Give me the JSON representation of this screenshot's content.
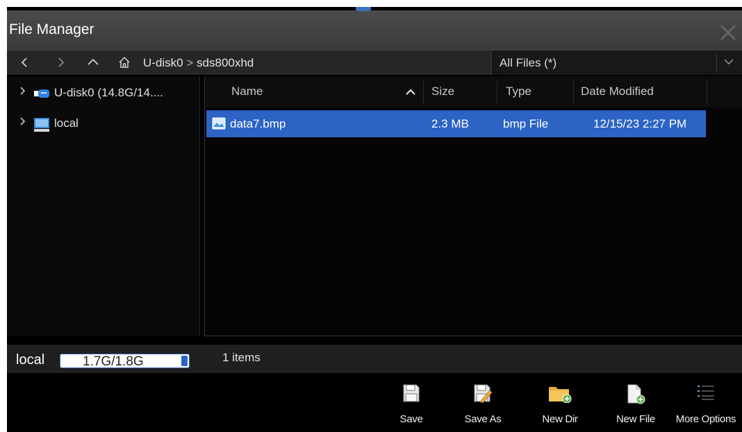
{
  "window": {
    "title": "File Manager",
    "close_icon": "close-icon"
  },
  "nav": {
    "back_icon": "chevron-left-icon",
    "forward_icon": "chevron-right-icon",
    "up_icon": "chevron-up-icon",
    "home_icon": "home-icon",
    "path_root": "U-disk0",
    "path_separator": ">",
    "path_folder": "sds800xhd",
    "filter": {
      "value": "All Files (*)",
      "icon": "chevron-down-icon"
    }
  },
  "sidebar": {
    "items": [
      {
        "label": "U-disk0  (14.8G/14....",
        "icon": "usb-drive-icon",
        "expand_icon": "chevron-right-icon"
      },
      {
        "label": "local",
        "icon": "monitor-drive-icon",
        "expand_icon": "chevron-right-icon"
      }
    ]
  },
  "file_list": {
    "columns": [
      "Name",
      "Size",
      "Type",
      "Date Modified"
    ],
    "sort_icon": "sort-ascending-icon",
    "rows": [
      {
        "name": "data7.bmp",
        "size": "2.3 MB",
        "type": "bmp File",
        "date": "12/15/23 2:27 PM",
        "icon": "image-file-icon"
      }
    ]
  },
  "status": {
    "storage_name": "local",
    "storage_usage": "1.7G/1.8G",
    "storage_fraction": 0.94,
    "item_count": "1 items"
  },
  "toolbar": {
    "buttons": [
      {
        "label": "Save",
        "icon": "floppy-disk-icon"
      },
      {
        "label": "Save As",
        "icon": "floppy-pencil-icon"
      },
      {
        "label": "New Dir",
        "icon": "new-folder-icon"
      },
      {
        "label": "New File",
        "icon": "new-file-icon"
      },
      {
        "label": "More Options",
        "icon": "list-icon"
      }
    ]
  },
  "colors": {
    "accent": "#2c63c4",
    "background": "#000000",
    "title_bar": "#444444"
  }
}
